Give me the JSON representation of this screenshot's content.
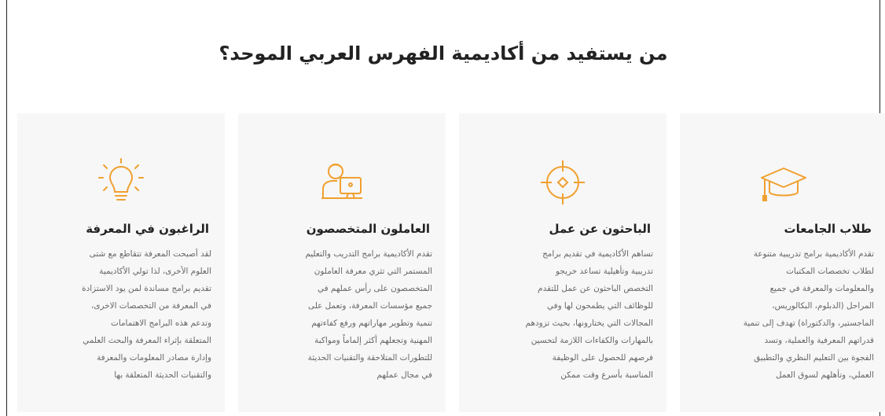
{
  "heading": "من يستفيد من أكاديمية الفهرس العربي الموحد؟",
  "colors": {
    "accent": "#f0a030",
    "card_bg": "#f7f7f7"
  },
  "cards": [
    {
      "icon": "graduation-cap-icon",
      "title": "طلاب الجامعات",
      "lines": [
        "تقدم الأكاديمية برامج تدريبية متنوعة",
        "لطلاب تخصصات المكتبات",
        "والمعلومات والمعرفة في جميع",
        "المراحل (الدبلوم، البكالوريس،",
        "الماجستير، والدكتوراة) تهدف إلى تنمية",
        "قدراتهم المعرفية والعملية، وتسد",
        "الفجوة بين التعليم النظري والتطبيق",
        "العملي، وتأهلهم لسوق العمل"
      ]
    },
    {
      "icon": "target-icon",
      "title": "الباحثون عن عمل",
      "lines": [
        "تساهم الأكاديمية في تقديم برامج",
        "تدريبية وتأهيلية تساعد خريجو",
        "التخصص الباحثون عن عمل للتقدم",
        "للوظائف التي يطمحون لها وفي",
        "المجالات التي يختارونها، بحيث تزودهم",
        "بالمهارات والكفاءات اللازمة لتحسين",
        "فرصهم للحصول على الوظيفة",
        "المناسبة بأسرع وقت ممكن"
      ]
    },
    {
      "icon": "professional-at-computer-icon",
      "title": "العاملون المتخصصون",
      "lines": [
        "تقدم الأكاديمية برامج التدريب والتعليم",
        "المستمر التي تثري معرفة العاملون",
        "المتخصصون على رأس عملهم في",
        "جميع مؤسسات المعرفة، وتعمل على",
        "تنمية وتطوير مهاراتهم ورفع كفاءتهم",
        "المهنية وتجعلهم أكثر إلماماً ومواكبة",
        "للتطورات المتلاحقة والتقنيات الحديثة",
        "في مجال عملهم"
      ]
    },
    {
      "icon": "lightbulb-icon",
      "title": "الراغبون في المعرفة",
      "lines": [
        "لقد أصبحت المعرفة تتقاطع مع شتى",
        "العلوم الأخرى، لذا تولي الأكاديمية",
        "تقديم برامج مساندة لمن يود الاستزادة",
        "في المعرفة من التخصصات الاخرى،",
        "وتدعم هذه البرامج الاهتمامات",
        "المتعلقة بإثراء المعرفة والبحث العلمي",
        "وإدارة مصادر المعلومات والمعرفة",
        "والتقنيات الحديثة المتعلقة بها"
      ]
    }
  ]
}
